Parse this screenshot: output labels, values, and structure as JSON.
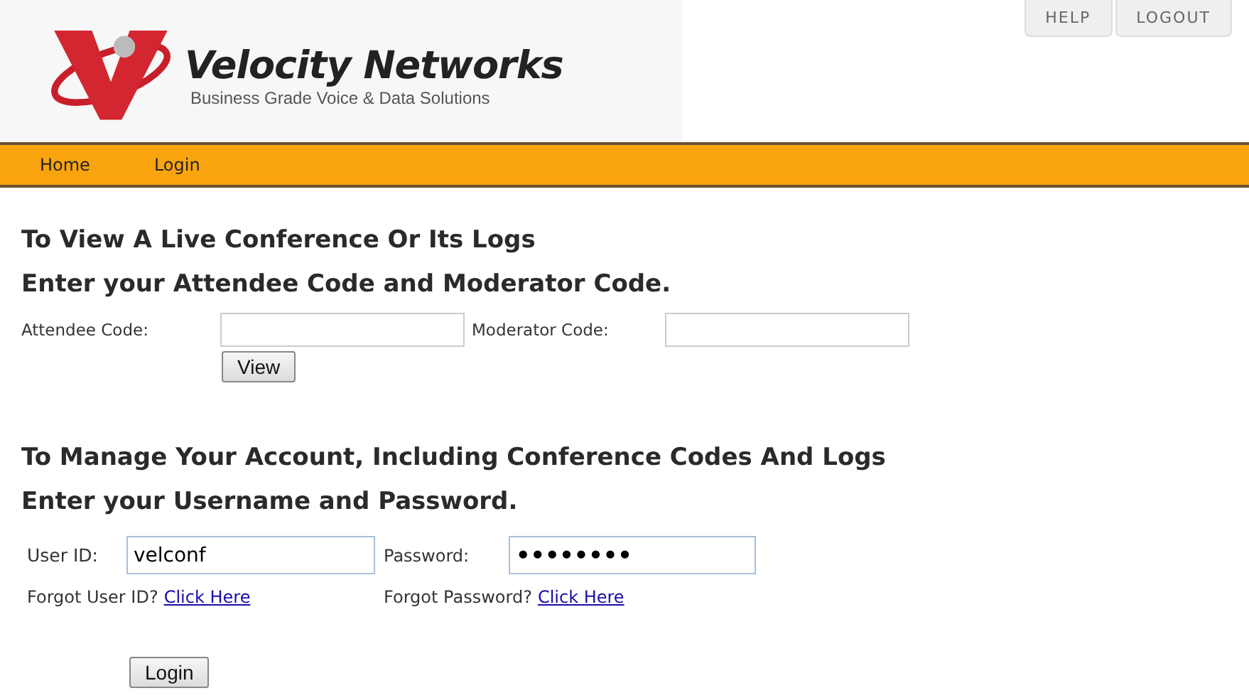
{
  "header": {
    "brand": "Velocity Networks",
    "tagline": "Business Grade Voice & Data Solutions"
  },
  "top_tabs": [
    {
      "label": "HELP"
    },
    {
      "label": "LOGOUT"
    }
  ],
  "nav": [
    {
      "label": "Home"
    },
    {
      "label": "Login"
    }
  ],
  "conference": {
    "title": "To View A Live Conference Or Its Logs",
    "subtitle": "Enter your Attendee Code and Moderator Code.",
    "fields": [
      {
        "label": "Attendee Code:"
      },
      {
        "label": "Moderator Code:"
      }
    ],
    "button": "View"
  },
  "account": {
    "title": "To Manage Your Account, Including Conference Codes And Logs",
    "subtitle": "Enter your Username and Password.",
    "fields": [
      {
        "label": "User ID:",
        "value": "velconf",
        "forgot": "Forgot User ID?",
        "link": "Click Here"
      },
      {
        "label": "Password:",
        "value": "••••••••",
        "forgot": "Forgot Password?",
        "link": "Click Here"
      }
    ],
    "button": "Login"
  }
}
